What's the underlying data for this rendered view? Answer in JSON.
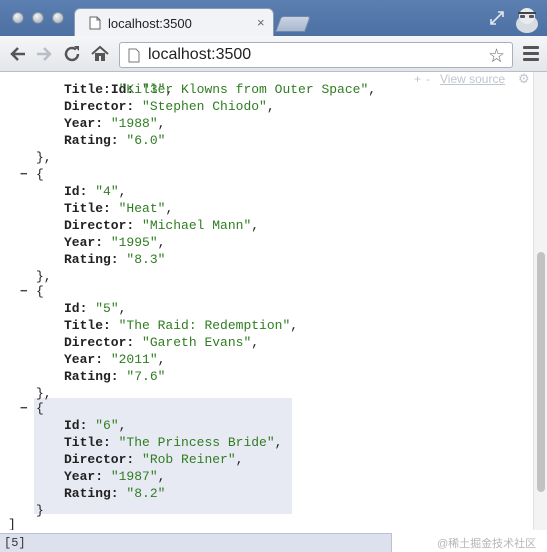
{
  "tab": {
    "title": "localhost:3500",
    "close": "×"
  },
  "omnibox": {
    "url": "localhost:3500"
  },
  "json_viewer": {
    "controls": {
      "plus": "+",
      "minus": "-",
      "view_source": "View source",
      "gear": "⚙"
    },
    "open_bracket_partial": "Id: \"3\",",
    "toggle_symbol": "−",
    "open_brace": "{",
    "close_brace": "}",
    "close_brace_comma": "},",
    "close_bracket": "]",
    "entries": [
      {
        "Id": "\"3\"",
        "Title": "\"Killer Klowns from Outer Space\"",
        "Director": "\"Stephen Chiodo\"",
        "Year": "\"1988\"",
        "Rating": "\"6.0\""
      },
      {
        "Id": "\"4\"",
        "Title": "\"Heat\"",
        "Director": "\"Michael Mann\"",
        "Year": "\"1995\"",
        "Rating": "\"8.3\""
      },
      {
        "Id": "\"5\"",
        "Title": "\"The Raid: Redemption\"",
        "Director": "\"Gareth Evans\"",
        "Year": "\"2011\"",
        "Rating": "\"7.6\""
      },
      {
        "Id": "\"6\"",
        "Title": "\"The Princess Bride\"",
        "Director": "\"Rob Reiner\"",
        "Year": "\"1987\"",
        "Rating": "\"8.2\""
      }
    ],
    "keys": {
      "id": "Id:",
      "title": "Title:",
      "director": "Director:",
      "year": "Year:",
      "rating": "Rating:"
    }
  },
  "status": {
    "path": "[5]"
  },
  "watermark": "@稀土掘金技术社区",
  "colors": {
    "string": "#2f7d22",
    "highlight": "#e8eaf3",
    "tabstrip": "#5b7fb0"
  }
}
